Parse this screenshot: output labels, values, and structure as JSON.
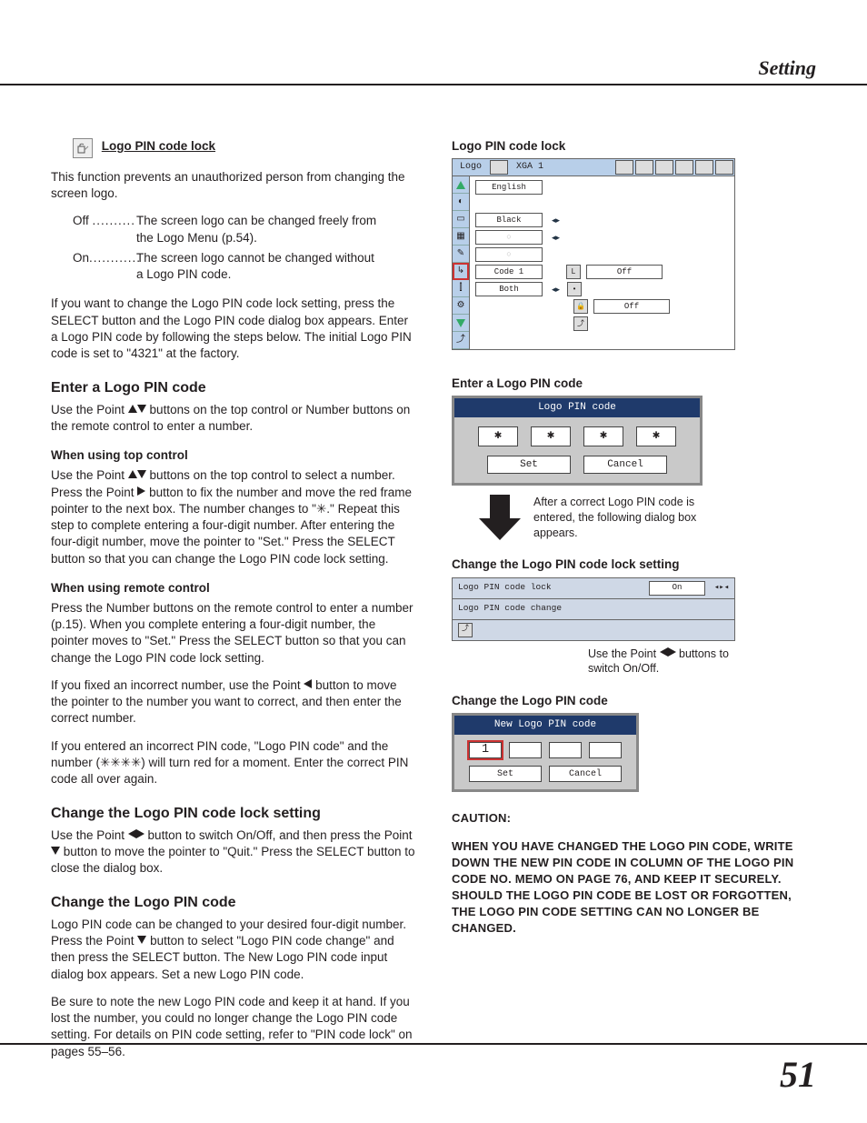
{
  "header": {
    "title": "Setting"
  },
  "page_number": "51",
  "left": {
    "logo_lock": {
      "heading": "Logo PIN code lock",
      "intro": "This function prevents an unauthorized person from changing the screen logo.",
      "off_term": "Off",
      "off_desc1": "The screen logo can be changed freely from",
      "off_desc2": "the Logo Menu (p.54).",
      "on_term": "On",
      "on_desc1": "The screen logo cannot be changed without",
      "on_desc2": "a Logo PIN code.",
      "para": "If you want to change the Logo PIN code lock setting, press the SELECT button and the Logo PIN code dialog box appears. Enter a Logo PIN code by following the steps below. The initial Logo PIN code is set to \"4321\" at the factory."
    },
    "enter": {
      "heading": "Enter a Logo PIN code",
      "intro_a": "Use the Point ",
      "intro_b": " buttons on the top control or Number buttons on the remote control to enter a number.",
      "top_h": "When using top control",
      "top_a": "Use the Point ",
      "top_b": " buttons on the top control to select a number. Press the Point ",
      "top_c": " button to fix the number and move the red frame pointer to the next box. The number changes to \"✳.\" Repeat this step to complete entering a four-digit number. After entering the four-digit number, move the pointer to \"Set.\" Press the SELECT button so that you can change the Logo PIN code lock setting.",
      "rc_h": "When using remote control",
      "rc_p1": "Press the Number buttons on the remote control to enter a number (p.15). When you complete entering a four-digit number, the pointer moves to \"Set.\" Press the SELECT button so that you can change the Logo PIN code lock setting.",
      "rc_p2a": "If you fixed an incorrect number, use the Point ",
      "rc_p2b": " button to move the pointer to the number you want to correct, and then enter the correct number.",
      "rc_p3": "If you entered an incorrect PIN code, \"Logo PIN code\" and the number (✳✳✳✳) will turn red for a moment. Enter the correct PIN code all over again."
    },
    "change_lock": {
      "heading": "Change the Logo PIN code lock setting",
      "p_a": "Use the Point ",
      "p_b": " button to switch On/Off, and then press the Point ",
      "p_c": " button to move the pointer to \"Quit.\" Press the SELECT button to close the dialog box."
    },
    "change_code": {
      "heading": "Change the Logo PIN code",
      "p1a": "Logo PIN code can be changed to your desired four-digit number. Press the Point ",
      "p1b": " button to select \"Logo PIN code change\" and then press the SELECT button. The New Logo PIN code input dialog box appears. Set a new Logo PIN code.",
      "p2": "Be sure to note the new Logo PIN code and keep it at hand. If you lost the number, you could no longer change the Logo PIN code setting. For details on PIN code setting, refer to \"PIN code lock\" on pages 55–56."
    }
  },
  "right": {
    "osd": {
      "heading": "Logo PIN code lock",
      "logo_label": "Logo",
      "mode_label": "XGA 1",
      "rows": {
        "english": "English",
        "black": "Black",
        "code1": "Code 1",
        "both": "Both",
        "off1": "Off",
        "off2": "Off"
      }
    },
    "enter_h": "Enter a Logo PIN code",
    "pin_dialog": {
      "title": "Logo PIN code",
      "cell": "✱",
      "set": "Set",
      "cancel": "Cancel"
    },
    "after_note": "After a correct Logo PIN code is entered, the following dialog box appears.",
    "change_lock_h": "Change the Logo PIN code lock setting",
    "lock_panel": {
      "row1": "Logo PIN code lock",
      "row1_val": "On",
      "row2": "Logo PIN code change"
    },
    "switch_note_a": "Use the Point ",
    "switch_note_b": " buttons to switch On/Off.",
    "change_code_h": "Change the Logo PIN code",
    "new_pin": {
      "title": "New Logo PIN code",
      "first": "1",
      "set": "Set",
      "cancel": "Cancel"
    },
    "caution_h": "CAUTION:",
    "caution_body": "WHEN YOU HAVE CHANGED THE LOGO PIN CODE, WRITE DOWN THE NEW PIN CODE IN COLUMN OF THE LOGO PIN CODE NO. MEMO ON PAGE 76, AND KEEP IT SECURELY. SHOULD THE LOGO PIN CODE BE LOST OR FORGOTTEN, THE LOGO PIN CODE SETTING CAN NO LONGER BE CHANGED."
  }
}
